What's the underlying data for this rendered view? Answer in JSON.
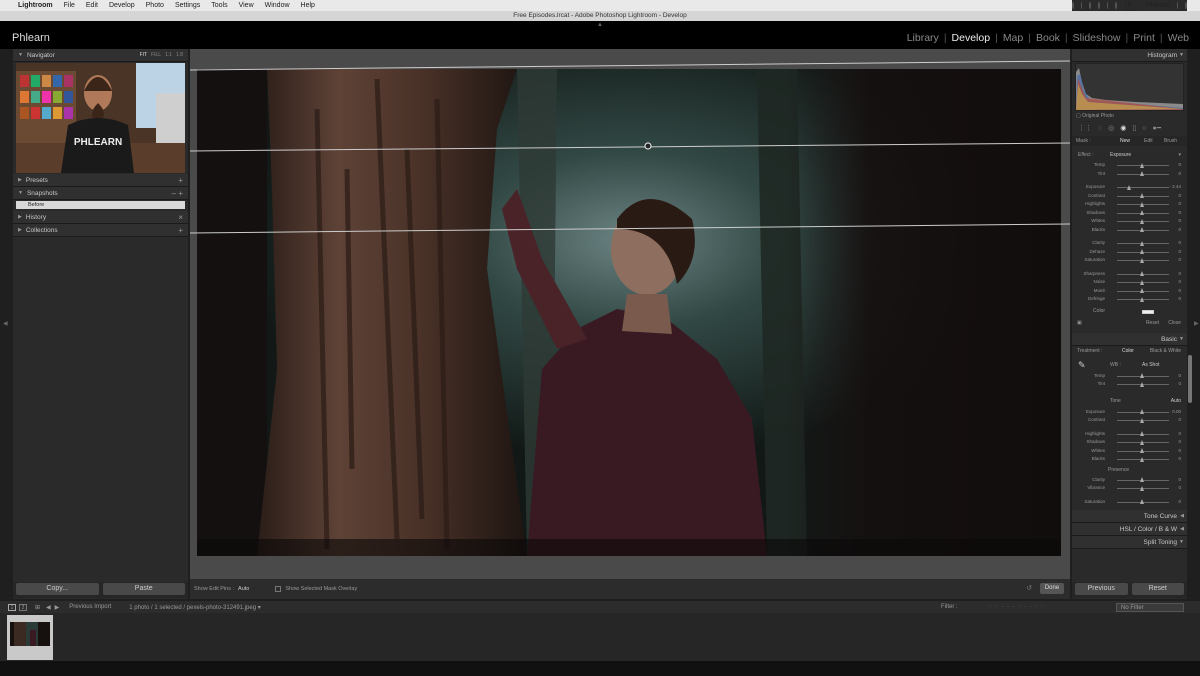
{
  "menubar": {
    "app": "Lightroom",
    "items": [
      "File",
      "Edit",
      "Develop",
      "Photo",
      "Settings",
      "Tools",
      "View",
      "Window",
      "Help"
    ],
    "clock": "Thu Mar 16  2:56 PM",
    "user": "Phlearn"
  },
  "window_title": "Free Episodes.lrcat - Adobe Photoshop Lightroom - Develop",
  "identity_plate": "Phlearn",
  "modules": [
    "Library",
    "Develop",
    "Map",
    "Book",
    "Slideshow",
    "Print",
    "Web"
  ],
  "active_module": "Develop",
  "left_panel": {
    "navigator": {
      "title": "Navigator",
      "options": [
        "FIT",
        "FILL",
        "1:1",
        "1:8"
      ],
      "overlay_text": "PHLEARN"
    },
    "presets": {
      "title": "Presets",
      "action": "+"
    },
    "snapshots": {
      "title": "Snapshots",
      "actions": "–  +",
      "items": [
        "Before"
      ]
    },
    "history": {
      "title": "History",
      "action": "×"
    },
    "collections": {
      "title": "Collections",
      "action": "+"
    },
    "copy_label": "Copy...",
    "paste_label": "Paste"
  },
  "toolbar": {
    "show_edit_pins_label": "Show Edit Pins :",
    "show_edit_pins_value": "Auto",
    "overlay_label": "Show Selected Mask Overlay",
    "done_label": "Done"
  },
  "right_panel": {
    "histogram": {
      "title": "Histogram",
      "original_photo": "Original Photo"
    },
    "mask": {
      "label": "Mask :",
      "options": [
        "New",
        "Edit",
        "Brush"
      ]
    },
    "effect": {
      "label": "Effect :",
      "value": "Exposure",
      "sliders": [
        {
          "label": "Temp",
          "value": "0"
        },
        {
          "label": "Tint",
          "value": "0"
        },
        {
          "label": "Exposure",
          "value": "- 2.44"
        },
        {
          "label": "Contrast",
          "value": "0"
        },
        {
          "label": "Highlights",
          "value": "0"
        },
        {
          "label": "Shadows",
          "value": "0"
        },
        {
          "label": "Whites",
          "value": "0"
        },
        {
          "label": "Blacks",
          "value": "0"
        },
        {
          "label": "Clarity",
          "value": "0"
        },
        {
          "label": "Dehaze",
          "value": "0"
        },
        {
          "label": "Saturation",
          "value": "0"
        },
        {
          "label": "Sharpness",
          "value": "0"
        },
        {
          "label": "Noise",
          "value": "0"
        },
        {
          "label": "Moiré",
          "value": "0"
        },
        {
          "label": "Defringe",
          "value": "0"
        }
      ],
      "color_label": "Color",
      "reset_label": "Reset",
      "close_label": "Close"
    },
    "basic": {
      "title": "Basic",
      "treatment_label": "Treatment :",
      "treatment_color": "Color",
      "treatment_bw": "Black & White",
      "wb_label": "WB :",
      "wb_value": "As Shot",
      "wb_sliders": [
        {
          "label": "Temp",
          "value": "0"
        },
        {
          "label": "Tint",
          "value": "0"
        }
      ],
      "tone_label": "Tone",
      "auto_label": "Auto",
      "tone_sliders": [
        {
          "label": "Exposure",
          "value": "0.00"
        },
        {
          "label": "Contrast",
          "value": "0"
        },
        {
          "label": "Highlights",
          "value": "0"
        },
        {
          "label": "Shadows",
          "value": "0"
        },
        {
          "label": "Whites",
          "value": "0"
        },
        {
          "label": "Blacks",
          "value": "0"
        }
      ],
      "presence_label": "Presence",
      "presence_sliders": [
        {
          "label": "Clarity",
          "value": "0"
        },
        {
          "label": "Vibrance",
          "value": "0"
        },
        {
          "label": "Saturation",
          "value": "0"
        }
      ]
    },
    "tone_curve": "Tone Curve",
    "hsl": "HSL  /  Color  /  B & W",
    "split_toning": "Split Toning",
    "previous_label": "Previous",
    "reset_label": "Reset"
  },
  "filmstrip": {
    "source": "Previous Import",
    "status": "1 photo / 1 selected / pexels-photo-312491.jpeg ▾",
    "filter_label": "Filter :",
    "filter_value": "No Filter"
  }
}
